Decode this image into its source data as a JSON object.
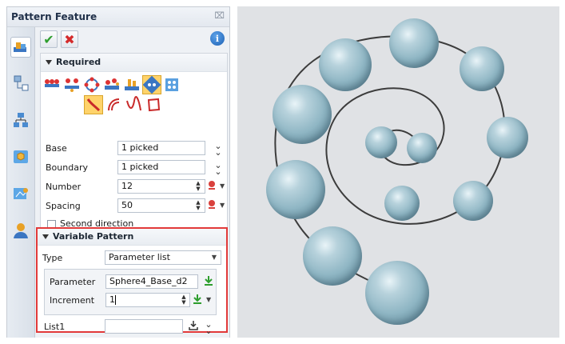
{
  "panel": {
    "title": "Pattern Feature",
    "close_glyph": "⌧",
    "ok_glyph": "✔",
    "cancel_glyph": "✖",
    "info_glyph": "i"
  },
  "required": {
    "heading": "Required",
    "base_label": "Base",
    "base_value": "1 picked",
    "boundary_label": "Boundary",
    "boundary_value": "1 picked",
    "number_label": "Number",
    "number_value": "12",
    "spacing_label": "Spacing",
    "spacing_value": "50",
    "second_direction_label": "Second direction",
    "second_direction_checked": false
  },
  "variable": {
    "heading": "Variable Pattern",
    "type_label": "Type",
    "type_value": "Parameter list",
    "parameter_label": "Parameter",
    "parameter_value": "Sphere4_Base_d2",
    "increment_label": "Increment",
    "increment_value": "1",
    "list_label": "List1",
    "list_value": ""
  },
  "colors": {
    "highlight_border": "#e23a3a",
    "selected_icon": "#ffd36a",
    "sphere": "#8fb6c4",
    "viewport_bg": "#e0e2e5"
  }
}
